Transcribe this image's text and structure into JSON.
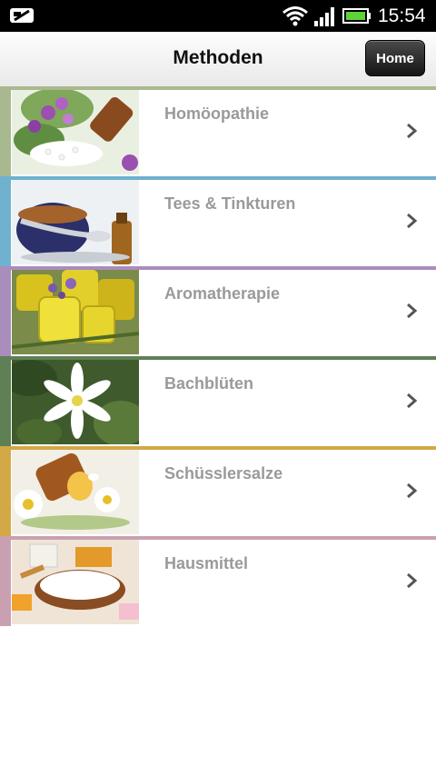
{
  "status_bar": {
    "time": "15:54",
    "icons": [
      "sim-icon",
      "wifi-icon",
      "signal-icon",
      "battery-icon"
    ]
  },
  "header": {
    "title": "Methoden",
    "home_label": "Home"
  },
  "methods": [
    {
      "label": "Homöopathie",
      "color": "#a9b98f",
      "image": "globuli-flowers-image"
    },
    {
      "label": "Tees & Tinkturen",
      "color": "#6fb1cf",
      "image": "tea-cup-image"
    },
    {
      "label": "Aromatherapie",
      "color": "#a98dbb",
      "image": "oil-bottles-image"
    },
    {
      "label": "Bachblüten",
      "color": "#5f7f55",
      "image": "white-flower-image"
    },
    {
      "label": "Schüsslersalze",
      "color": "#d3a846",
      "image": "daisies-pills-image"
    },
    {
      "label": "Hausmittel",
      "color": "#c9a0b1",
      "image": "honey-bowl-image"
    }
  ]
}
